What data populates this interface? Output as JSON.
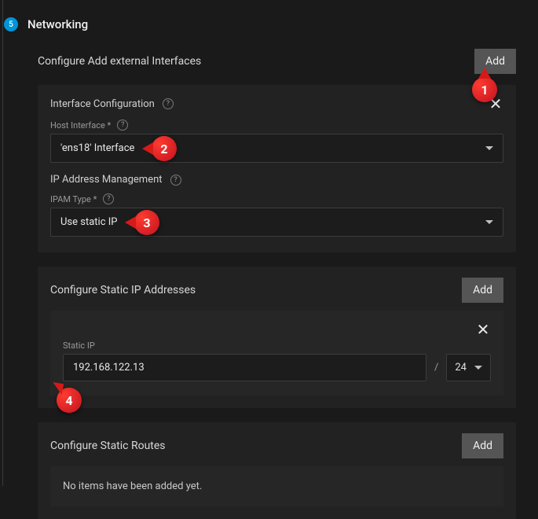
{
  "step": {
    "number": "5",
    "title": "Networking"
  },
  "external": {
    "label": "Configure Add external Interfaces",
    "add": "Add"
  },
  "interface": {
    "title": "Interface Configuration",
    "host_label": "Host Interface *",
    "host_value": "'ens18' Interface",
    "ipam_title": "IP Address Management",
    "ipam_type_label": "IPAM Type *",
    "ipam_type_value": "Use static IP"
  },
  "static_ip": {
    "label": "Configure Static IP Addresses",
    "add": "Add",
    "field_label": "Static IP",
    "value": "192.168.122.13",
    "slash": "/",
    "prefix": "24"
  },
  "routes": {
    "label": "Configure Static Routes",
    "add": "Add",
    "empty": "No items have been added yet."
  },
  "annotations": {
    "a1": "1",
    "a2": "2",
    "a3": "3",
    "a4": "4"
  }
}
